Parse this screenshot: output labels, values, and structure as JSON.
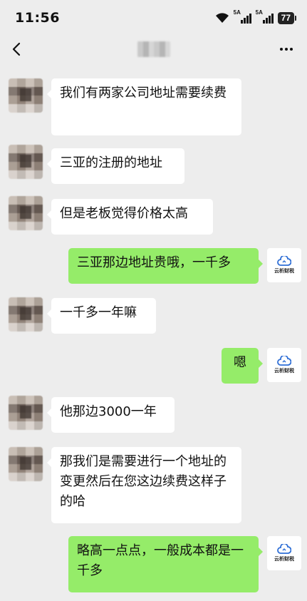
{
  "status_bar": {
    "time": "11:56",
    "signal1_label": "5A",
    "signal2_label": "5A",
    "battery": "77"
  },
  "nav": {
    "back_icon": "chevron-left-icon",
    "more_icon": "more-dots-icon"
  },
  "my_avatar": {
    "brand": "云析财税"
  },
  "messages": [
    {
      "side": "in",
      "text": "我们有两家公司地址需要续费"
    },
    {
      "side": "in",
      "text": "三亚的注册的地址"
    },
    {
      "side": "in",
      "text": "但是老板觉得价格太高"
    },
    {
      "side": "out",
      "text": "三亚那边地址贵哦，一千多"
    },
    {
      "side": "in",
      "text": "一千多一年嘛"
    },
    {
      "side": "out",
      "text": "嗯"
    },
    {
      "side": "in",
      "text": "他那边3000一年"
    },
    {
      "side": "in",
      "text": "那我们是需要进行一个地址的变更然后在您这边续费这样子的哈"
    },
    {
      "side": "out",
      "text": "略高一点点，一般成本都是一千多"
    }
  ],
  "colors": {
    "background": "#ededed",
    "outgoing_bubble": "#95ec69",
    "incoming_bubble": "#ffffff"
  }
}
